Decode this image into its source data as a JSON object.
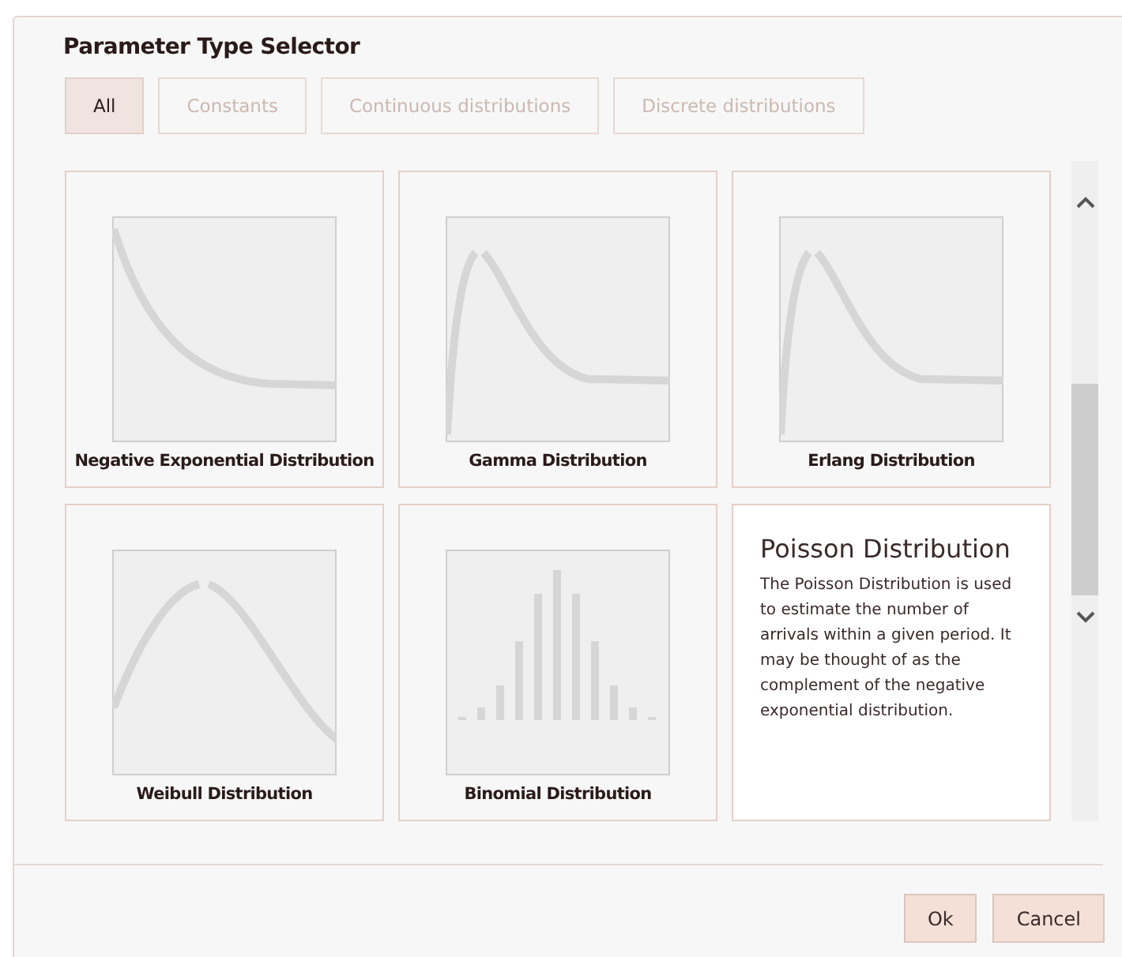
{
  "dialog": {
    "title": "Parameter Type Selector"
  },
  "filters": [
    {
      "label": "All",
      "selected": true
    },
    {
      "label": "Constants",
      "selected": false
    },
    {
      "label": "Continuous distributions",
      "selected": false
    },
    {
      "label": "Discrete distributions",
      "selected": false
    }
  ],
  "cards": [
    {
      "kind": "decay",
      "label": "Negative Exponential Distribution"
    },
    {
      "kind": "peak",
      "label": "Gamma Distribution"
    },
    {
      "kind": "peak",
      "label": "Erlang Distribution"
    },
    {
      "kind": "hump",
      "label": "Weibull Distribution"
    },
    {
      "kind": "bars",
      "label": "Binomial Distribution"
    },
    {
      "kind": "description",
      "label": "Poisson Distribution",
      "description": "The Poisson Distribution is used to estimate the number of arrivals within a given period. It may be thought of as the complement of the negative exponential distribution."
    }
  ],
  "buttons": [
    {
      "label": "Ok"
    },
    {
      "label": "Cancel"
    }
  ]
}
